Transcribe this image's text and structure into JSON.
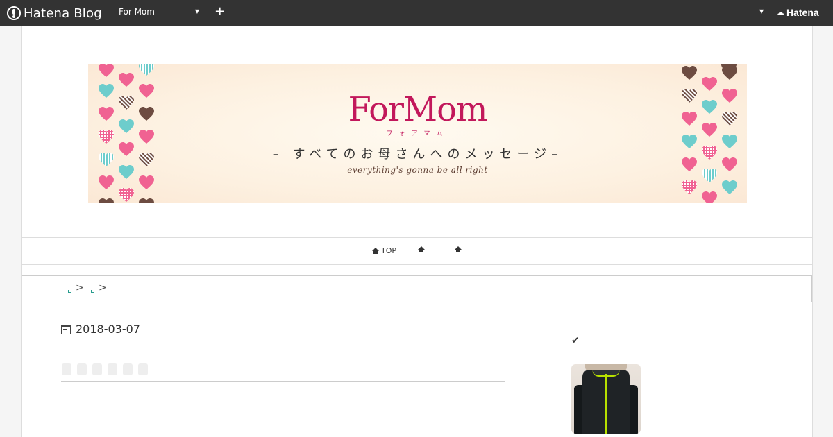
{
  "topbar": {
    "brand": "Hatena Blog",
    "blog_selector": "For Mom --",
    "add_icon": "plus-icon",
    "account_brand": "Hatena"
  },
  "banner": {
    "title": "ForMom",
    "kana": "フォアマム",
    "subtitle": "– すべてのお母さんへのメッセージ–",
    "tagline": "everything's gonna be all right",
    "colors": {
      "pink": "#f06292",
      "teal": "#6dcdcc",
      "brown": "#6d4c41",
      "title": "#c2185b"
    }
  },
  "nav": {
    "items": [
      {
        "label": "TOP",
        "icon": "home-icon"
      },
      {
        "label": "",
        "icon": "home-icon"
      },
      {
        "label": "",
        "icon": "home-icon"
      }
    ]
  },
  "breadcrumb": {
    "separator": ">"
  },
  "article": {
    "date": "2018-03-07",
    "date_icon": "calendar-icon"
  },
  "sidebar": {
    "section_icon": "check-icon",
    "thumbnail": "jacket-photo"
  }
}
